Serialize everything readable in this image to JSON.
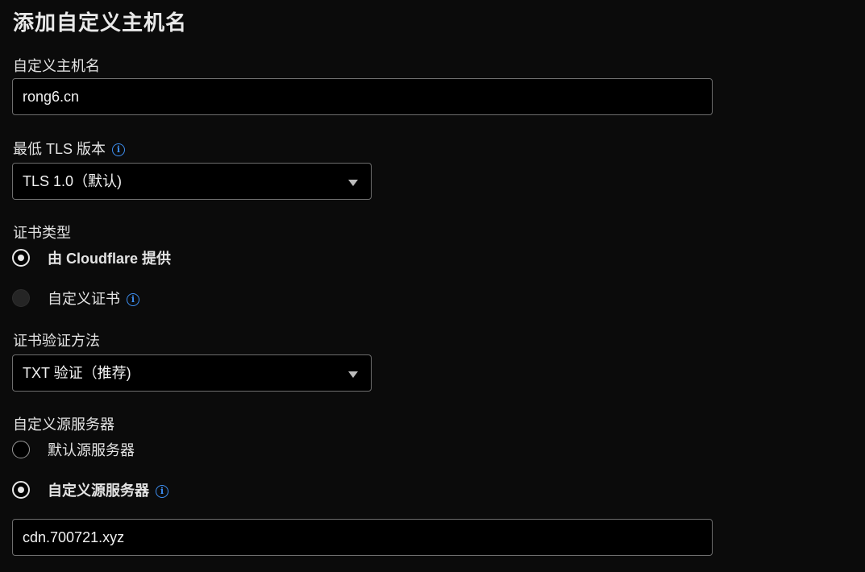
{
  "page": {
    "title": "添加自定义主机名"
  },
  "hostname": {
    "label": "自定义主机名",
    "value": "rong6.cn"
  },
  "tls": {
    "label": "最低 TLS 版本",
    "info_icon": "info-icon",
    "selected": "TLS 1.0（默认)"
  },
  "certificate_type": {
    "label": "证书类型",
    "options": [
      {
        "label": "由 Cloudflare 提供",
        "checked": true
      },
      {
        "label": "自定义证书",
        "checked": false,
        "disabled": true
      }
    ]
  },
  "verification": {
    "label": "证书验证方法",
    "selected": "TXT 验证（推荐)"
  },
  "origin_server": {
    "label": "自定义源服务器",
    "options": [
      {
        "label": "默认源服务器",
        "checked": false
      },
      {
        "label": "自定义源服务器",
        "checked": true
      }
    ],
    "value": "cdn.700721.xyz"
  },
  "colors": {
    "background": "#0b0b0b",
    "info_blue": "#3d8ef0",
    "border": "#6e6e6e"
  }
}
